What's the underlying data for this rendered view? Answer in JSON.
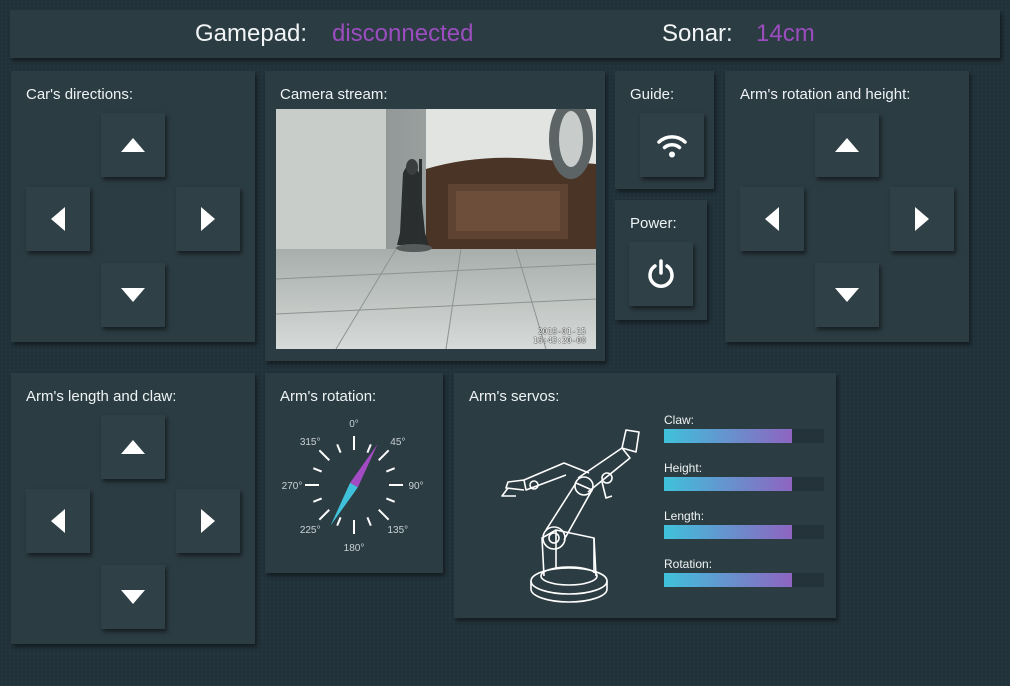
{
  "header": {
    "gamepad_label": "Gamepad:",
    "gamepad_status": "disconnected",
    "sonar_label": "Sonar:",
    "sonar_value": "14cm",
    "status_color": "#9b4dbf"
  },
  "panels": {
    "car_directions": "Car's directions:",
    "camera_stream": "Camera stream:",
    "guide": "Guide:",
    "power": "Power:",
    "arm_rotation_height": "Arm's rotation and height:",
    "arm_length_claw": "Arm's length and claw:",
    "arm_rotation": "Arm's rotation:",
    "arm_servos": "Arm's servos:"
  },
  "camera": {
    "timestamp_date": "2019-01-15",
    "timestamp_time": "16:43:20-00"
  },
  "compass": {
    "labels": [
      "0°",
      "45°",
      "90°",
      "135°",
      "180°",
      "225°",
      "270°",
      "315°"
    ],
    "needle_degrees": 30
  },
  "servos": [
    {
      "name": "Claw:",
      "level": 0.8
    },
    {
      "name": "Height:",
      "level": 0.8
    },
    {
      "name": "Length:",
      "level": 0.8
    },
    {
      "name": "Rotation:",
      "level": 0.8
    }
  ],
  "icons": {
    "up": "arrow-up-icon",
    "down": "arrow-down-icon",
    "left": "arrow-left-icon",
    "right": "arrow-right-icon",
    "guide": "wifi-icon",
    "power": "power-icon"
  },
  "colors": {
    "background": "#22323a",
    "panel": "#2c3c43",
    "accent_cyan": "#3fc1db",
    "accent_purple": "#8e64c0"
  }
}
